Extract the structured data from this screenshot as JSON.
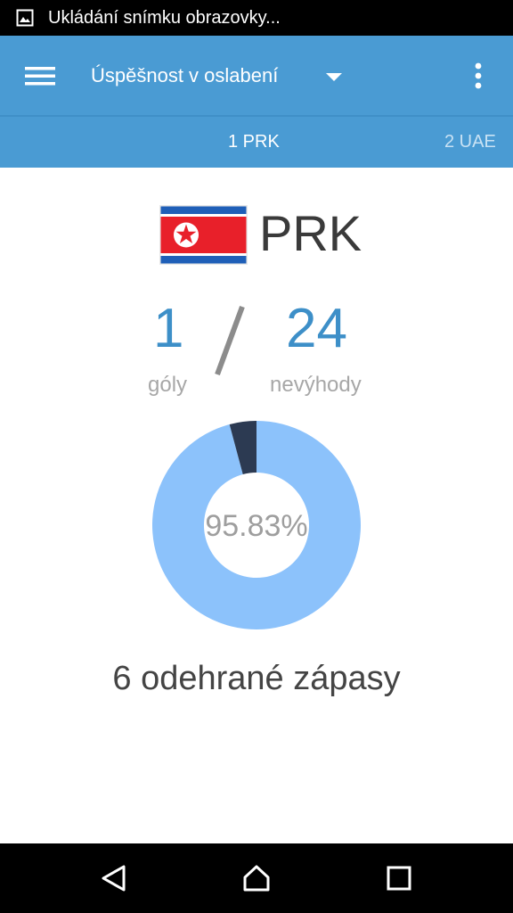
{
  "status_bar": {
    "notification_text": "Ukládání snímku obrazovky..."
  },
  "app_bar": {
    "title": "Úspěšnost v oslabení"
  },
  "tabs": [
    {
      "label": "1 PRK",
      "active": true
    },
    {
      "label": "2 UAE",
      "active": false
    }
  ],
  "team": {
    "code": "PRK"
  },
  "stats": {
    "goals_value": "1",
    "goals_label": "góly",
    "disadvantages_value": "24",
    "disadvantages_label": "nevýhody"
  },
  "donut": {
    "percent_label": "95.83%",
    "success_fraction": 0.9583,
    "success_color": "#8cc2fb",
    "fail_color": "#2c3a52"
  },
  "matches_text": "6 odehrané zápasy",
  "colors": {
    "primary": "#4a9bd3",
    "accent_number": "#3d8fc8"
  }
}
